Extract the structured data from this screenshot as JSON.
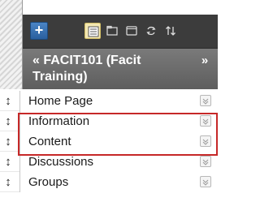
{
  "toolbar": {
    "add_label": "+",
    "icons": [
      "list-view-icon",
      "folder-icon",
      "window-icon",
      "refresh-icon",
      "sort-icon"
    ]
  },
  "course": {
    "collapse_label": "«",
    "title": "FACIT101 (Facit Training)",
    "expand_label": "»"
  },
  "menu": {
    "items": [
      {
        "label": "Home Page"
      },
      {
        "label": "Information"
      },
      {
        "label": "Content"
      },
      {
        "label": "Discussions"
      },
      {
        "label": "Groups"
      }
    ]
  },
  "colors": {
    "toolbar_bg": "#3c3c3c",
    "header_bg": "#6a6a6a",
    "add_button": "#2f6db0",
    "highlight": "#c62828"
  }
}
